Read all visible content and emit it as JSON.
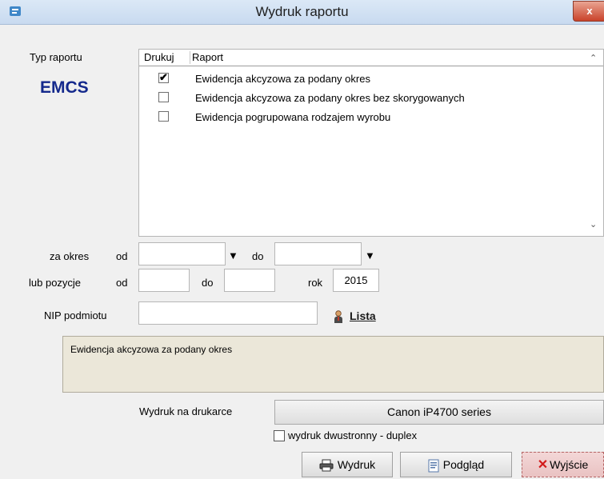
{
  "window": {
    "title": "Wydruk raportu",
    "close": "x"
  },
  "report_type": {
    "label": "Typ raportu",
    "system": "EMCS"
  },
  "list": {
    "col_print": "Drukuj",
    "col_report": "Raport",
    "items": [
      {
        "checked": true,
        "check_mark": "✔",
        "label": "Ewidencja akcyzowa za podany okres"
      },
      {
        "checked": false,
        "check_mark": "",
        "label": "Ewidencja akcyzowa za podany okres bez skorygowanych"
      },
      {
        "checked": false,
        "check_mark": "",
        "label": "Ewidencja pogrupowana rodzajem wyrobu"
      }
    ]
  },
  "period": {
    "label": "za okres",
    "od": "od",
    "do": "do",
    "from_value": "",
    "to_value": ""
  },
  "positions": {
    "label": "lub pozycje",
    "od": "od",
    "do": "do",
    "rok": "rok",
    "from_value": "",
    "to_value": "",
    "year_value": "2015"
  },
  "nip": {
    "label": "NIP podmiotu",
    "value": "",
    "lista": "Lista"
  },
  "description": "Ewidencja akcyzowa za podany okres",
  "printer": {
    "label": "Wydruk na drukarce",
    "name": "Canon iP4700 series"
  },
  "duplex": {
    "label": "wydruk dwustronny - duplex",
    "checked": false
  },
  "buttons": {
    "print": "Wydruk",
    "preview": "Podgląd",
    "exit": "Wyjście"
  }
}
